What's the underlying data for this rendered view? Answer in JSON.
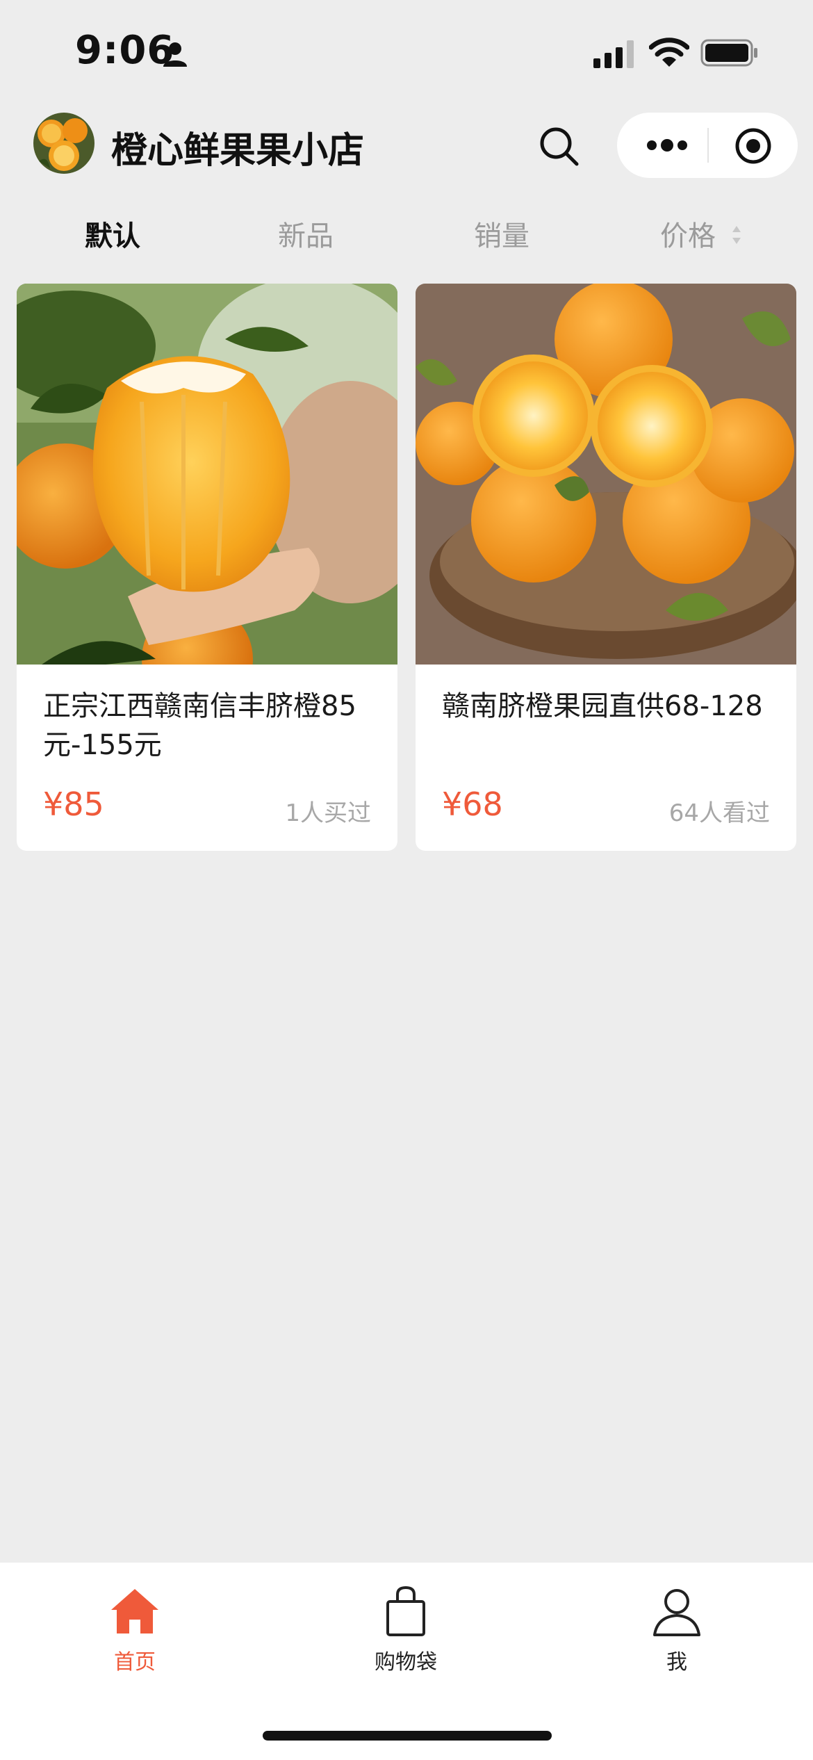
{
  "status_bar": {
    "time": "9:06"
  },
  "header": {
    "shop_name": "橙心鲜果果小店"
  },
  "sort_tabs": [
    {
      "label": "默认",
      "active": true
    },
    {
      "label": "新品",
      "active": false
    },
    {
      "label": "销量",
      "active": false
    },
    {
      "label": "价格",
      "active": false
    }
  ],
  "products": [
    {
      "title": "正宗江西赣南信丰脐橙85元-155元",
      "price": "¥85",
      "meta": "1人买过"
    },
    {
      "title": "赣南脐橙果园直供68-128",
      "price": "¥68",
      "meta": "64人看过"
    }
  ],
  "tabbar": {
    "items": [
      {
        "label": "首页",
        "icon": "home-icon",
        "active": true
      },
      {
        "label": "购物袋",
        "icon": "shopping-bag-icon",
        "active": false
      },
      {
        "label": "我",
        "icon": "user-icon",
        "active": false
      }
    ]
  },
  "colors": {
    "accent": "#ef5a3a",
    "background": "#ededed",
    "muted_text": "#a7a7a7"
  }
}
